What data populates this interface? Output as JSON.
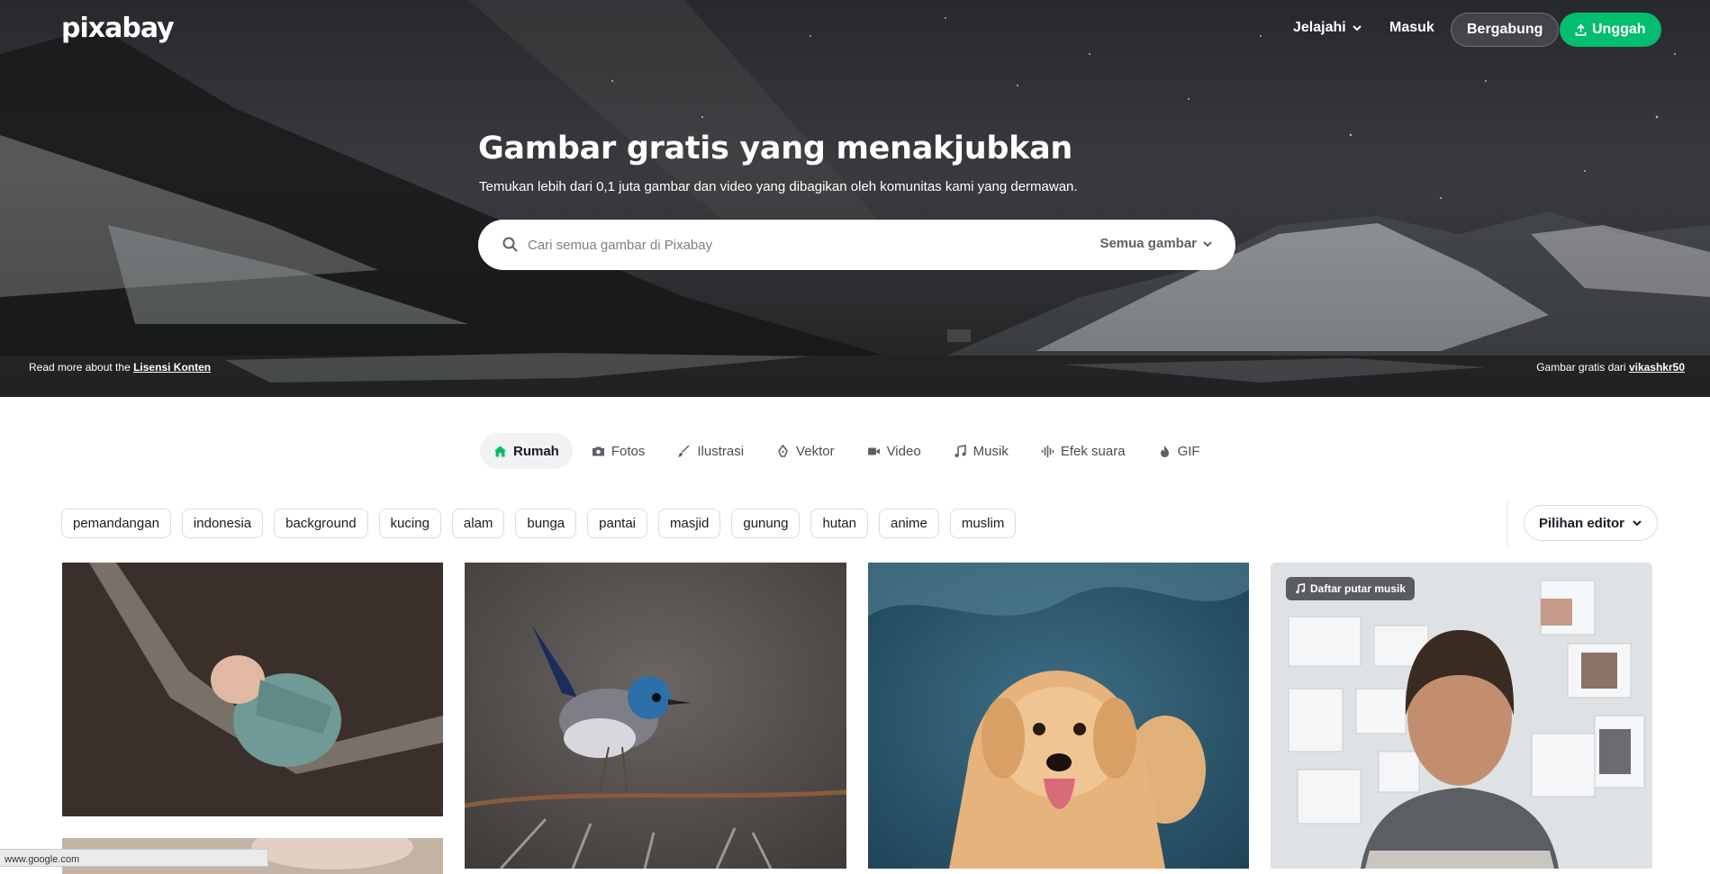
{
  "brand": {
    "logo": "pixabay",
    "accent": "#02be6e"
  },
  "nav": {
    "explore_label": "Jelajahi",
    "login_label": "Masuk",
    "join_label": "Bergabung",
    "upload_label": "Unggah"
  },
  "hero": {
    "title": "Gambar gratis yang menakjubkan",
    "subtitle": "Temukan lebih dari 0,1 juta gambar dan video yang dibagikan oleh komunitas kami yang dermawan.",
    "search_placeholder": "Cari semua gambar di Pixabay",
    "search_type": "Semua gambar",
    "footer_left_text": "Read more about the",
    "footer_left_link": "Lisensi Konten",
    "footer_right_text": "Gambar gratis dari",
    "footer_right_link": "vikashkr50"
  },
  "tabs": [
    {
      "label": "Rumah",
      "icon": "home-icon",
      "active": true
    },
    {
      "label": "Fotos",
      "icon": "camera-icon"
    },
    {
      "label": "Ilustrasi",
      "icon": "brush-icon"
    },
    {
      "label": "Vektor",
      "icon": "pen-nib-icon"
    },
    {
      "label": "Video",
      "icon": "video-camera-icon"
    },
    {
      "label": "Musik",
      "icon": "music-note-icon"
    },
    {
      "label": "Efek suara",
      "icon": "sound-wave-icon"
    },
    {
      "label": "GIF",
      "icon": "flame-icon"
    }
  ],
  "tags": [
    "pemandangan",
    "indonesia",
    "background",
    "kucing",
    "alam",
    "bunga",
    "pantai",
    "masjid",
    "gunung",
    "hutan",
    "anime",
    "muslim"
  ],
  "sort": {
    "label": "Pilihan editor"
  },
  "grid": {
    "playlist_badge": "Daftar putar musik"
  },
  "statusbar": {
    "text": "www.google.com"
  }
}
